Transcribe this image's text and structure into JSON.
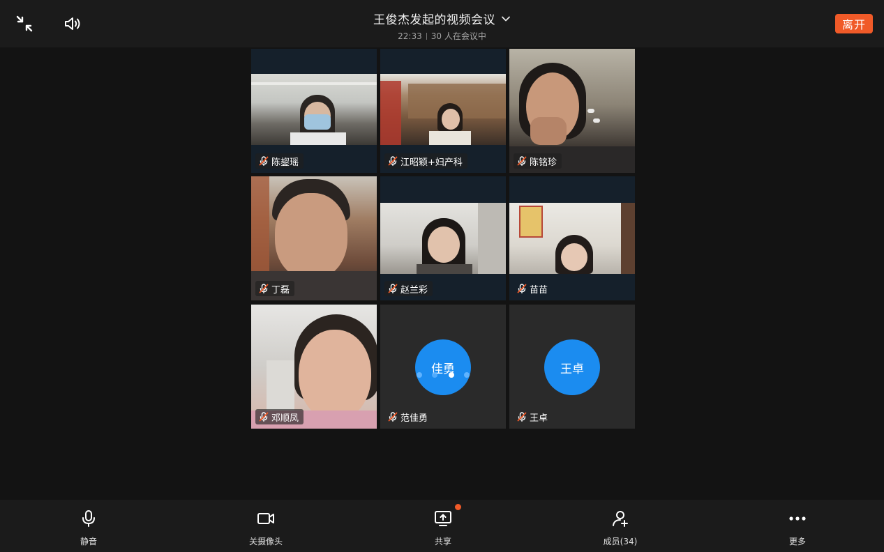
{
  "header": {
    "title": "王俊杰发起的视频会议",
    "time": "22:33",
    "participants_text": "30 人在会议中",
    "leave_label": "离开",
    "icons": [
      "collapse-icon",
      "speaker-icon",
      "chevron-down-icon"
    ]
  },
  "grid": {
    "tiles": [
      {
        "name": "陈鋆瑶",
        "muted": true,
        "type": "video-letterbox"
      },
      {
        "name": "江昭颖+妇产科",
        "muted": true,
        "type": "video-letterbox"
      },
      {
        "name": "陈铭珍",
        "muted": true,
        "type": "video-full"
      },
      {
        "name": "丁磊",
        "muted": true,
        "type": "video-full"
      },
      {
        "name": "赵兰彩",
        "muted": true,
        "type": "video-letterbox"
      },
      {
        "name": "苗苗",
        "muted": true,
        "type": "video-letterbox"
      },
      {
        "name": "邓顺凤",
        "muted": true,
        "type": "video-full"
      },
      {
        "name": "范佳勇",
        "muted": true,
        "type": "avatar",
        "avatar_text": "佳勇",
        "speaking": true
      },
      {
        "name": "王卓",
        "muted": true,
        "type": "avatar",
        "avatar_text": "王卓",
        "speaking": false
      }
    ],
    "avatar_color": "#1b8cf0"
  },
  "toolbar": {
    "items": [
      {
        "label": "静音",
        "icon": "microphone-icon"
      },
      {
        "label": "关摄像头",
        "icon": "camera-icon"
      },
      {
        "label": "共享",
        "icon": "share-screen-icon",
        "badge": true
      },
      {
        "label": "成员(34)",
        "icon": "add-member-icon"
      },
      {
        "label": "更多",
        "icon": "more-icon"
      }
    ]
  },
  "colors": {
    "accent": "#f05a28",
    "background": "#131313",
    "bar": "#1b1b1b"
  }
}
